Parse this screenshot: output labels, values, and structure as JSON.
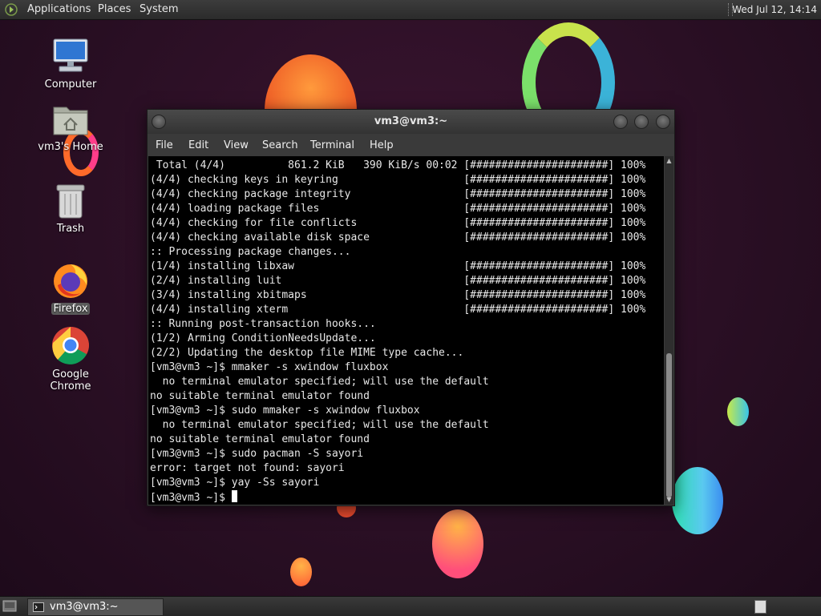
{
  "top_panel": {
    "menus": [
      "Applications",
      "Places",
      "System"
    ],
    "clock": "Wed Jul 12, 14:14"
  },
  "desktop_icons": [
    {
      "label": "Computer"
    },
    {
      "label": "vm3's Home"
    },
    {
      "label": "Trash"
    },
    {
      "label": "Firefox"
    },
    {
      "label": "Google Chrome"
    }
  ],
  "terminal": {
    "title": "vm3@vm3:~",
    "menu": [
      "File",
      "Edit",
      "View",
      "Search",
      "Terminal",
      "Help"
    ],
    "lines": [
      " Total (4/4)          861.2 KiB   390 KiB/s 00:02 [######################] 100%",
      "(4/4) checking keys in keyring                    [######################] 100%",
      "(4/4) checking package integrity                  [######################] 100%",
      "(4/4) loading package files                       [######################] 100%",
      "(4/4) checking for file conflicts                 [######################] 100%",
      "(4/4) checking available disk space               [######################] 100%",
      ":: Processing package changes...",
      "(1/4) installing libxaw                           [######################] 100%",
      "(2/4) installing luit                             [######################] 100%",
      "(3/4) installing xbitmaps                         [######################] 100%",
      "(4/4) installing xterm                            [######################] 100%",
      ":: Running post-transaction hooks...",
      "(1/2) Arming ConditionNeedsUpdate...",
      "(2/2) Updating the desktop file MIME type cache...",
      "[vm3@vm3 ~]$ mmaker -s xwindow fluxbox",
      "  no terminal emulator specified; will use the default",
      "no suitable terminal emulator found",
      "[vm3@vm3 ~]$ sudo mmaker -s xwindow fluxbox",
      "  no terminal emulator specified; will use the default",
      "no suitable terminal emulator found",
      "[vm3@vm3 ~]$ sudo pacman -S sayori",
      "error: target not found: sayori",
      "[vm3@vm3 ~]$ yay -Ss sayori"
    ],
    "prompt": "[vm3@vm3 ~]$ "
  },
  "taskbar": {
    "task_label": "vm3@vm3:~"
  }
}
